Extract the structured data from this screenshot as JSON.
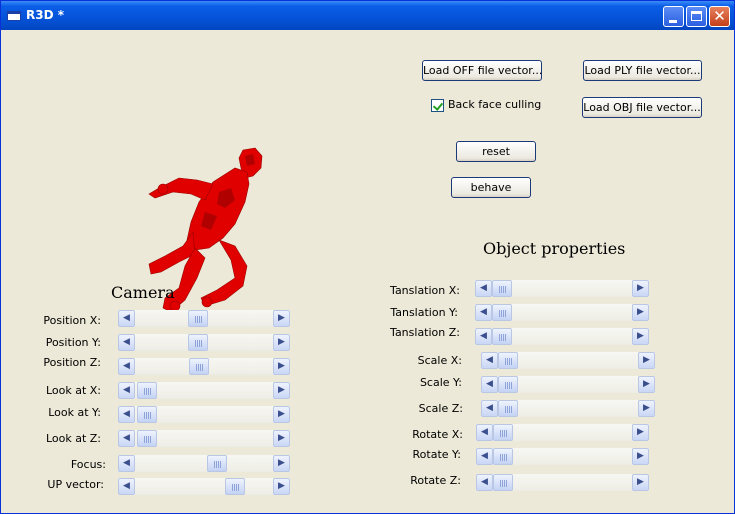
{
  "window": {
    "title": "R3D *",
    "controls": {
      "minimize": "minimize-icon",
      "maximize": "maximize-icon",
      "close": "close-icon"
    }
  },
  "buttons": {
    "load_off": "Load OFF file vector...",
    "load_ply": "Load PLY file vector...",
    "load_obj": "Load OBJ file vector...",
    "reset": "reset",
    "behave": "behave"
  },
  "backface": {
    "label": "Back face culling",
    "checked": true
  },
  "camera": {
    "heading": "Camera",
    "sliders": [
      {
        "label": "Position X:",
        "value": 0.45
      },
      {
        "label": "Position Y:",
        "value": 0.45
      },
      {
        "label": "Position Z:",
        "value": 0.46
      },
      {
        "label": "Look at X:",
        "value": 0.02
      },
      {
        "label": "Look at Y:",
        "value": 0.02
      },
      {
        "label": "Look at Z:",
        "value": 0.02
      },
      {
        "label": "Focus:",
        "value": 0.61
      },
      {
        "label": "UP vector:",
        "value": 0.76
      }
    ]
  },
  "object": {
    "heading": "Object properties",
    "sliders": [
      {
        "label": "Tanslation X:",
        "value": 0.0
      },
      {
        "label": "Tanslation Y:",
        "value": 0.0
      },
      {
        "label": "Tanslation Z:",
        "value": 0.0
      },
      {
        "label": "Scale X:",
        "value": 0.0
      },
      {
        "label": "Scale Y:",
        "value": 0.0
      },
      {
        "label": "Scale Z:",
        "value": 0.0
      },
      {
        "label": "Rotate X:",
        "value": 0.0
      },
      {
        "label": "Rotate Y:",
        "value": 0.0
      },
      {
        "label": "Rotate Z:",
        "value": 0.0
      }
    ]
  },
  "colors": {
    "model": "#e00000",
    "titlebar": "#0a5ee6",
    "background": "#ece9d8"
  }
}
